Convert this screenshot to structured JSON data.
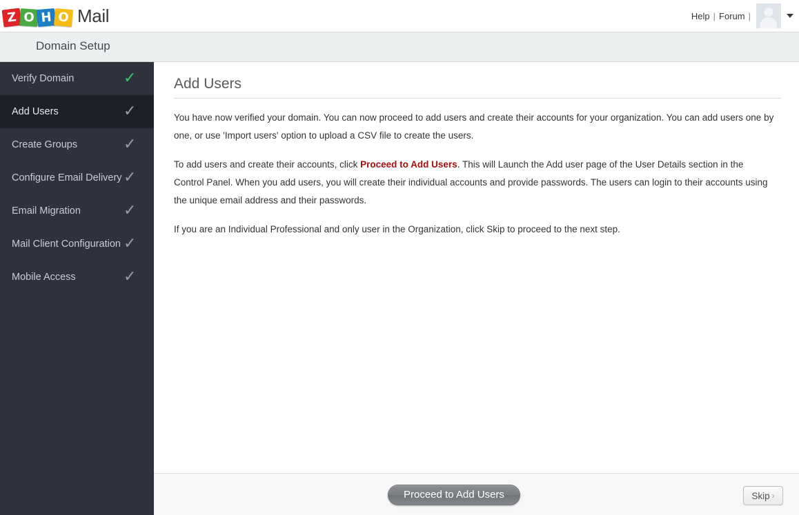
{
  "header": {
    "logo_tiles": [
      {
        "letter": "Z",
        "color": "#e02329"
      },
      {
        "letter": "O",
        "color": "#49a942"
      },
      {
        "letter": "H",
        "color": "#1c7fc4"
      },
      {
        "letter": "O",
        "color": "#f5bc16"
      }
    ],
    "brand_word": "Mail",
    "help_label": "Help",
    "separator_1": "|",
    "forum_label": "Forum",
    "separator_2": "|"
  },
  "section": {
    "title": "Domain Setup"
  },
  "sidebar": {
    "items": [
      {
        "label": "Verify Domain",
        "check": "✓",
        "state": "done",
        "active": false
      },
      {
        "label": "Add Users",
        "check": "✓",
        "state": "pending",
        "active": true
      },
      {
        "label": "Create Groups",
        "check": "✓",
        "state": "pending",
        "active": false
      },
      {
        "label": "Configure Email Delivery",
        "check": "✓",
        "state": "pending",
        "active": false
      },
      {
        "label": "Email Migration",
        "check": "✓",
        "state": "pending",
        "active": false
      },
      {
        "label": "Mail Client Configuration",
        "check": "✓",
        "state": "pending",
        "active": false
      },
      {
        "label": "Mobile Access",
        "check": "✓",
        "state": "pending",
        "active": false
      }
    ]
  },
  "main": {
    "page_title": "Add Users",
    "paragraph_1": "You have now verified your domain. You can now proceed to add users and create their accounts for your organization. You can add users one by one, or use 'Import users' option to upload a CSV file to create the users.",
    "paragraph_2_before": "To add users and create their accounts, click ",
    "paragraph_2_highlight": "Proceed to Add Users",
    "paragraph_2_after": ". This will Launch the Add user page of the User Details section in the Control Panel. When you add users, you will create their individual accounts and provide passwords. The users can login to their accounts using the unique email address and their passwords.",
    "paragraph_3": "If you are an Individual Professional and only user in the Organization, click Skip to proceed to the next step."
  },
  "footer": {
    "primary_button": "Proceed to Add Users",
    "skip_button": "Skip",
    "skip_chevron": "›"
  },
  "colors": {
    "sidebar_bg": "#2e323d",
    "sidebar_active_bg": "#1d2026",
    "check_done": "#37c46a",
    "check_pending": "#9a9da3",
    "section_bar_bg": "#eaeff0",
    "highlight_red": "#a90d0d",
    "footer_bg": "#f7f7f7"
  }
}
